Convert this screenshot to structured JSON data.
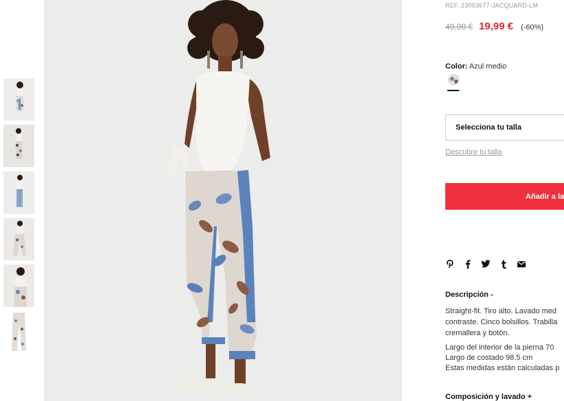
{
  "product": {
    "ref": "REF. 23053677-JACQUARD-LM",
    "old_price": "49,99 €",
    "new_price": "19,99 €",
    "discount": "(-60%)",
    "color_label": "Color:",
    "color_value": "Azul medio",
    "size_select": "Selecciona tu talla",
    "size_link": "Descubre tu talla",
    "add_button": "Añadir a la",
    "description_title": "Descripción -",
    "description_lines": [
      "Straight-fit. Tiro alto. Lavado med",
      "contraste. Cinco bolsillos. Trabilla",
      "cremallera y botón."
    ],
    "measure_lines": [
      "Largo del interior de la pierna 70",
      "Largo de costado 98.5 cm",
      "Estas medidas están calculadas p"
    ],
    "composition_title": "Composición y lavado +"
  },
  "share_icons": [
    "pinterest-icon",
    "facebook-icon",
    "twitter-icon",
    "tumblr-icon",
    "email-icon"
  ],
  "colors": {
    "accent": "#f0303c",
    "sale": "#e0252f"
  }
}
